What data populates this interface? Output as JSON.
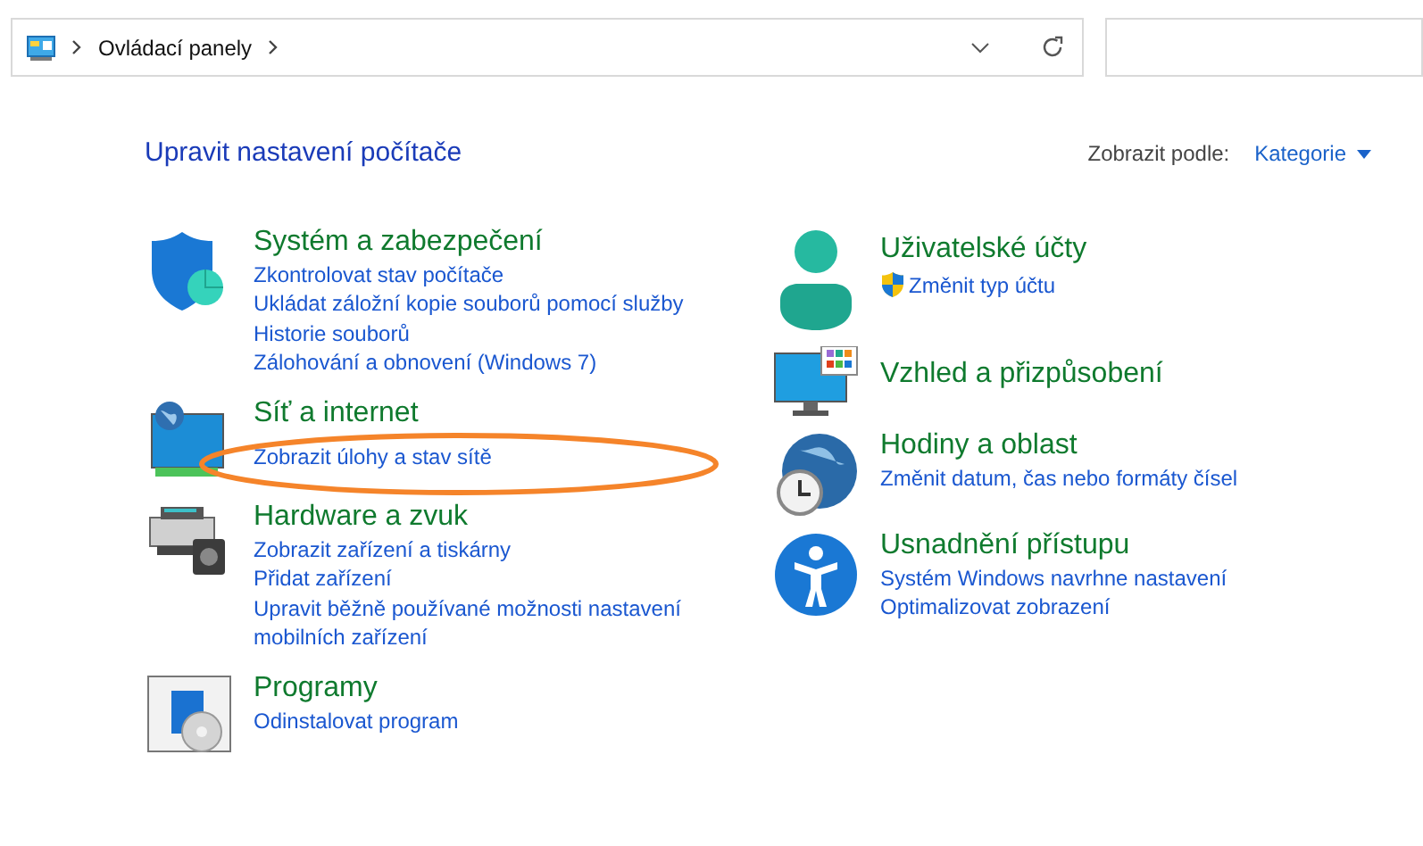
{
  "address_bar": {
    "path": [
      "Ovládací panely"
    ]
  },
  "heading": "Upravit nastavení počítače",
  "view_by": {
    "label": "Zobrazit podle:",
    "value": "Kategorie"
  },
  "columns": [
    {
      "categories": [
        {
          "kind": "shield",
          "title": "Systém a zabezpečení",
          "links": [
            {
              "text": "Zkontrolovat stav počítače"
            },
            {
              "text": "Ukládat záložní kopie souborů pomocí služby"
            },
            {
              "text": "Historie souborů"
            },
            {
              "text": "Zálohování a obnovení (Windows 7)"
            }
          ]
        },
        {
          "kind": "network",
          "title": "Síť a internet",
          "links": [
            {
              "text": "Zobrazit úlohy a stav sítě",
              "highlighted": true
            }
          ]
        },
        {
          "kind": "hardware",
          "title": "Hardware a zvuk",
          "links": [
            {
              "text": "Zobrazit zařízení a tiskárny"
            },
            {
              "text": "Přidat zařízení"
            },
            {
              "text": "Upravit běžně používané možnosti nastavení mobilních zařízení"
            }
          ]
        },
        {
          "kind": "programs",
          "title": "Programy",
          "links": [
            {
              "text": "Odinstalovat program"
            }
          ]
        }
      ]
    },
    {
      "categories": [
        {
          "kind": "user",
          "title": "Uživatelské účty",
          "links": [
            {
              "text": "Změnit typ účtu",
              "shield": true
            }
          ]
        },
        {
          "kind": "appearance",
          "title": "Vzhled a přizpůsobení"
        },
        {
          "kind": "clock",
          "title": "Hodiny a oblast",
          "links": [
            {
              "text": "Změnit datum, čas nebo formáty čísel"
            }
          ]
        },
        {
          "kind": "accessibility",
          "title": "Usnadnění přístupu",
          "links": [
            {
              "text": "Systém Windows navrhne nastavení"
            },
            {
              "text": "Optimalizovat zobrazení"
            }
          ]
        }
      ]
    }
  ]
}
